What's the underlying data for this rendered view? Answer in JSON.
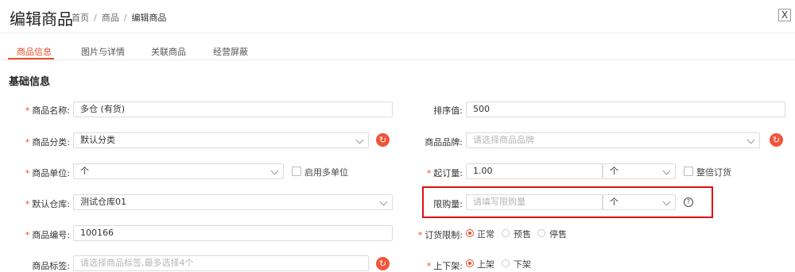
{
  "header": {
    "title": "编辑商品",
    "breadcrumb": [
      "首页",
      "商品",
      "编辑商品"
    ],
    "separator": "/",
    "close_label": "X"
  },
  "tabs": [
    {
      "label": "商品信息",
      "active": true
    },
    {
      "label": "图片与详情",
      "active": false
    },
    {
      "label": "关联商品",
      "active": false
    },
    {
      "label": "经营屏蔽",
      "active": false
    }
  ],
  "section_title": "基础信息",
  "required_mark": "*",
  "accent_color": "#e5502b",
  "fields": {
    "name": {
      "label": "商品名称:",
      "value": "多仓 (有货)"
    },
    "category": {
      "label": "商品分类:",
      "value": "默认分类"
    },
    "unit": {
      "label": "商品单位:",
      "value": "个",
      "checkbox_label": "启用多单位"
    },
    "warehouse": {
      "label": "默认仓库:",
      "value": "测试仓库01"
    },
    "code": {
      "label": "商品编号:",
      "value": "100166"
    },
    "tags": {
      "label": "商品标签:",
      "placeholder": "请选择商品标签,最多选择4个"
    },
    "sort": {
      "label": "排序值:",
      "value": "500"
    },
    "brand": {
      "label": "商品品牌:",
      "placeholder": "请选择商品品牌"
    },
    "min_order": {
      "label": "起订量:",
      "value": "1.00",
      "unit": "个",
      "checkbox_label": "整倍订货"
    },
    "purchase_limit": {
      "label": "限购量:",
      "placeholder": "请填写限购量",
      "unit": "个"
    },
    "order_limit": {
      "label": "订货限制:",
      "options": [
        "正常",
        "预售",
        "停售"
      ],
      "selected": "正常"
    },
    "shelf": {
      "label": "上下架:",
      "options": [
        "上架",
        "下架"
      ],
      "selected": "上架"
    }
  },
  "icons": {
    "refresh": "refresh-icon",
    "help": "question-circle-icon",
    "chevron": "chevron-down-icon"
  }
}
